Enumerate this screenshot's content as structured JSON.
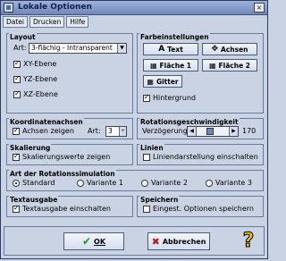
{
  "window": {
    "title": "Lokale Optionen",
    "close": "×"
  },
  "menu": [
    "Datei",
    "Drucken",
    "Hilfe"
  ],
  "layout": {
    "title": "Layout",
    "art_label": "Art:",
    "art_value": "3-flächig - Intransparent",
    "xy": "XY-Ebene",
    "yz": "YZ-Ebene",
    "xz": "XZ-Ebene"
  },
  "farbeinstellungen": {
    "title": "Farbeinstellungen",
    "text": "Text",
    "achsen": "Achsen",
    "flaeche1": "Fläche 1",
    "flaeche2": "Fläche 2",
    "gitter": "Gitter",
    "hintergrund": "Hintergrund"
  },
  "koordinatenachsen": {
    "title": "Koordinatenachsen",
    "achsen_zeigen": "Achsen zeigen",
    "art_label": "Art:",
    "art_value": "3"
  },
  "rotationsgeschwindigkeit": {
    "title": "Rotationsgeschwindigkeit",
    "label": "Verzögerung:",
    "value": "170",
    "level": 0.35
  },
  "skalierung": {
    "title": "Skalierung",
    "label": "Skalierungswerte zeigen"
  },
  "linien": {
    "title": "Linien",
    "label": "Liniendarstellung einschalten"
  },
  "rotationssimulation": {
    "title": "Art der Rotationssimulation",
    "options": [
      "Standard",
      "Variante 1",
      "Variante 2",
      "Variante 3"
    ]
  },
  "textausgabe": {
    "title": "Textausgabe",
    "label": "Textausgabe einschalten"
  },
  "speichern": {
    "title": "Speichern",
    "label": "Eingest. Optionen speichern"
  },
  "buttons": {
    "ok": "OK",
    "abbrechen": "Abbrechen",
    "help": "?"
  }
}
